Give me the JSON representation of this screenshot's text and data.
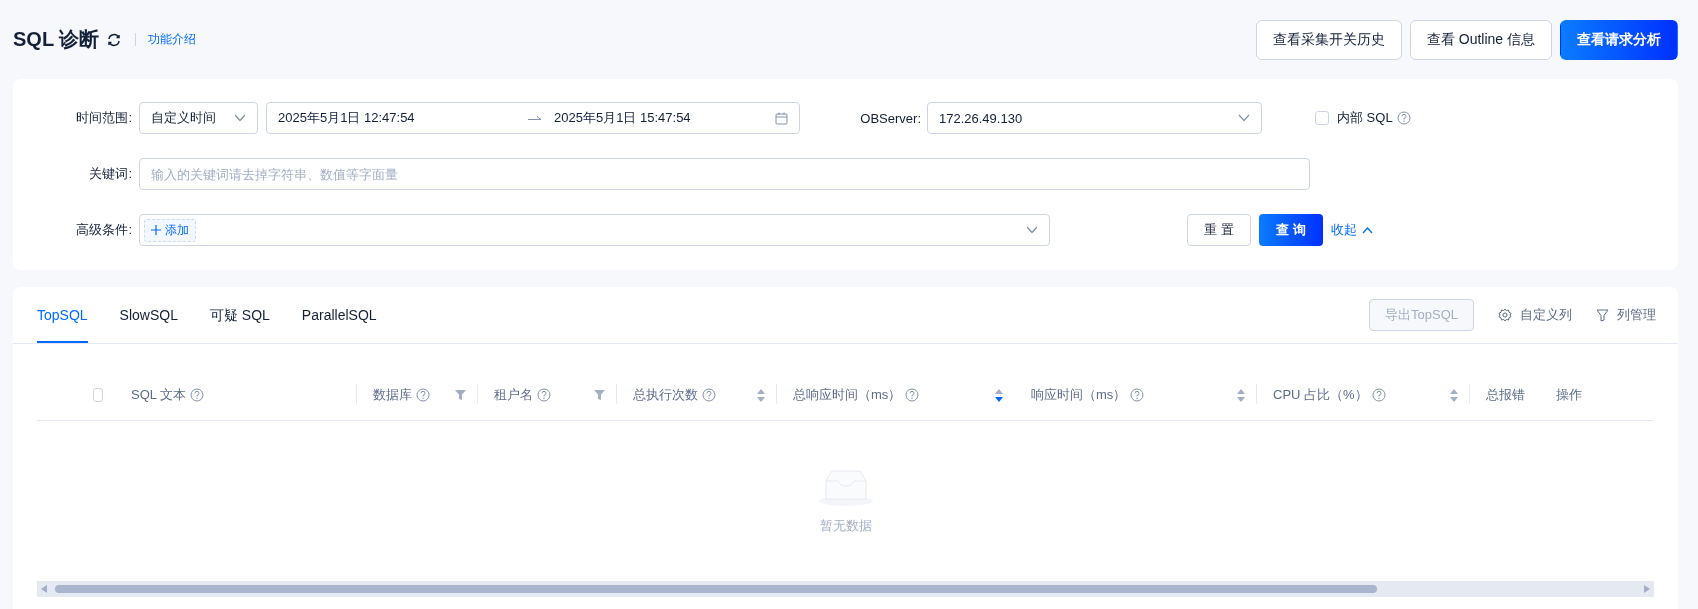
{
  "header": {
    "title": "SQL 诊断",
    "intro_link": "功能介绍",
    "buttons": [
      {
        "label": "查看采集开关历史",
        "primary": false
      },
      {
        "label": "查看 Outline 信息",
        "primary": false
      },
      {
        "label": "查看请求分析",
        "primary": true
      }
    ]
  },
  "filters": {
    "time_range": {
      "label": "时间范围:",
      "mode": "自定义时间",
      "start": "2025年5月1日 12:47:54",
      "end": "2025年5月1日 15:47:54"
    },
    "observer": {
      "label": "OBServer:",
      "value": "172.26.49.130"
    },
    "internal_sql": {
      "label": "内部 SQL",
      "checked": false
    },
    "keyword": {
      "label": "关键词:",
      "placeholder": "输入的关键词请去掉字符串、数值等字面量"
    },
    "advanced": {
      "label": "高级条件:",
      "add_tag": "添加"
    },
    "reset_button": "重 置",
    "query_button": "查 询",
    "collapse_link": "收起"
  },
  "tabs": [
    {
      "label": "TopSQL",
      "selected": true
    },
    {
      "label": "SlowSQL",
      "selected": false
    },
    {
      "label": "可疑 SQL",
      "selected": false
    },
    {
      "label": "ParallelSQL",
      "selected": false
    }
  ],
  "toolbar": {
    "export_button": {
      "label": "导出TopSQL",
      "disabled": true
    },
    "custom_columns": "自定义列",
    "column_manage": "列管理"
  },
  "table": {
    "select_all_checked": false,
    "columns": [
      {
        "title": "SQL 文本",
        "help": true,
        "kind": "plain"
      },
      {
        "title": "数据库",
        "help": true,
        "kind": "filter"
      },
      {
        "title": "租户名",
        "help": true,
        "kind": "filter"
      },
      {
        "title": "总执行次数",
        "help": true,
        "kind": "sort",
        "sort_descending": false
      },
      {
        "title": "总响应时间（ms）",
        "help": true,
        "kind": "sort",
        "sort_descending": true
      },
      {
        "title": "响应时间（ms）",
        "help": true,
        "kind": "sort",
        "sort_descending": false
      },
      {
        "title": "CPU 占比（%）",
        "help": true,
        "kind": "sort",
        "sort_descending": false
      },
      {
        "title": "总报错",
        "help": false,
        "kind": "plain"
      },
      {
        "title": "操作",
        "help": false,
        "kind": "plain"
      }
    ],
    "empty_text": "暂无数据"
  }
}
